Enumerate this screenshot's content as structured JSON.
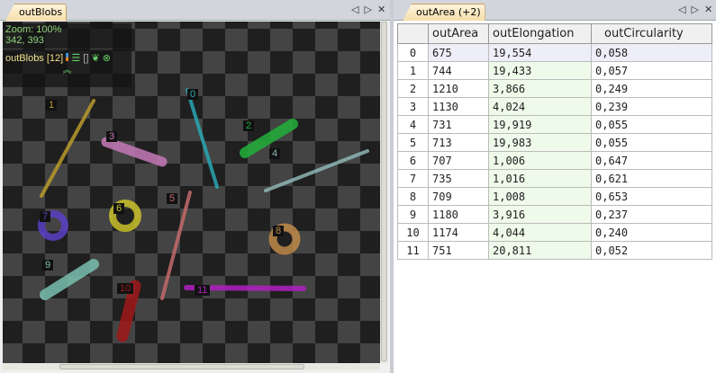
{
  "left_panel": {
    "tab": "outBlobs",
    "zoom": "Zoom: 100%",
    "coords": "342, 393",
    "blobs_label": "outBlobs",
    "blobs_count": "[12]"
  },
  "right_panel": {
    "tab": "outArea (+2)"
  },
  "controls": {
    "prev": "◁",
    "next": "▷",
    "close": "✕"
  },
  "table": {
    "columns": [
      "",
      "outArea",
      "outElongation",
      "outCircularity"
    ],
    "rows": [
      [
        "0",
        "675",
        "19,554",
        "0,058"
      ],
      [
        "1",
        "744",
        "19,433",
        "0,057"
      ],
      [
        "2",
        "1210",
        "3,866",
        "0,249"
      ],
      [
        "3",
        "1130",
        "4,024",
        "0,239"
      ],
      [
        "4",
        "731",
        "19,919",
        "0,055"
      ],
      [
        "5",
        "713",
        "19,983",
        "0,055"
      ],
      [
        "6",
        "707",
        "1,006",
        "0,647"
      ],
      [
        "7",
        "735",
        "1,016",
        "0,621"
      ],
      [
        "8",
        "709",
        "1,008",
        "0,653"
      ],
      [
        "9",
        "1180",
        "3,916",
        "0,237"
      ],
      [
        "10",
        "1174",
        "4,044",
        "0,240"
      ],
      [
        "11",
        "751",
        "20,811",
        "0,052"
      ]
    ]
  },
  "blobs": [
    {
      "id": "0",
      "color": "#2aa7b3"
    },
    {
      "id": "1",
      "color": "#b89a2a"
    },
    {
      "id": "2",
      "color": "#22b03a"
    },
    {
      "id": "3",
      "color": "#c57ab8"
    },
    {
      "id": "4",
      "color": "#8fb5b5"
    },
    {
      "id": "5",
      "color": "#c46a6a"
    },
    {
      "id": "6",
      "color": "#c9c12a"
    },
    {
      "id": "7",
      "color": "#5a3fc4"
    },
    {
      "id": "8",
      "color": "#c08a4a"
    },
    {
      "id": "9",
      "color": "#7ac0b0"
    },
    {
      "id": "10",
      "color": "#a01818"
    },
    {
      "id": "11",
      "color": "#b020c0"
    }
  ]
}
